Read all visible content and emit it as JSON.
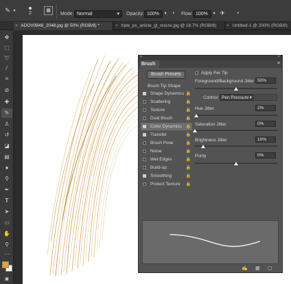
{
  "options_bar": {
    "brush_size": "2",
    "mode_label": "Mode:",
    "mode_value": "Normal",
    "opacity_label": "Opacity:",
    "opacity_value": "100%",
    "flow_label": "Flow:",
    "flow_value": "100%"
  },
  "tabs": [
    {
      "label": "ADOV0848_2048.jpg @ 50% (RGB/8) *",
      "close": "×"
    },
    {
      "label": "trple_px_article_gl_resize.jpg @ 16.7% (RGB/8)",
      "close": "×"
    },
    {
      "label": "Untitled-1 @ 200% (RGB/8)",
      "close": "×"
    }
  ],
  "brush_panel": {
    "title": "Brush",
    "brush_presets_button": "Brush Presets",
    "apply_per_tip": "Apply Per Tip",
    "brush_tip_shape": "Brush Tip Shape",
    "options": [
      {
        "label": "Shape Dynamics",
        "checked": true,
        "selected": false
      },
      {
        "label": "Scattering",
        "checked": false,
        "selected": false
      },
      {
        "label": "Texture",
        "checked": false,
        "selected": false
      },
      {
        "label": "Dual Brush",
        "checked": false,
        "selected": false
      },
      {
        "label": "Color Dynamics",
        "checked": true,
        "selected": true
      },
      {
        "label": "Transfer",
        "checked": true,
        "selected": false
      },
      {
        "label": "Brush Pose",
        "checked": false,
        "selected": false
      },
      {
        "label": "Noise",
        "checked": false,
        "selected": false
      },
      {
        "label": "Wet Edges",
        "checked": false,
        "selected": false
      },
      {
        "label": "Build-up",
        "checked": false,
        "selected": false
      },
      {
        "label": "Smoothing",
        "checked": true,
        "selected": false
      },
      {
        "label": "Protect Texture",
        "checked": false,
        "selected": false
      }
    ],
    "fg_bg_jitter_label": "Foreground/Background Jitter",
    "fg_bg_jitter_value": "50%",
    "fg_bg_jitter_level": 0.5,
    "control_label": "Control:",
    "control_value": "Pen Pressure",
    "hue_jitter_label": "Hue Jitter",
    "hue_jitter_value": "2%",
    "hue_jitter_level": 0.02,
    "saturation_jitter_label": "Saturation Jitter",
    "saturation_jitter_value": "0%",
    "saturation_jitter_level": 0.0,
    "brightness_jitter_label": "Brightness Jitter",
    "brightness_jitter_value": "10%",
    "brightness_jitter_level": 0.1,
    "purity_label": "Purity",
    "purity_value": "0%",
    "purity_level": 0.5
  },
  "colors": {
    "foreground": "#f0a020",
    "background": "#ffffff",
    "stroke": "#d4a55a",
    "panel": "#535353"
  },
  "icons": [
    "brush-tool-icon",
    "brush-preset-icon",
    "toggle-panel-icon",
    "airbrush-icon",
    "pressure-size-icon"
  ]
}
